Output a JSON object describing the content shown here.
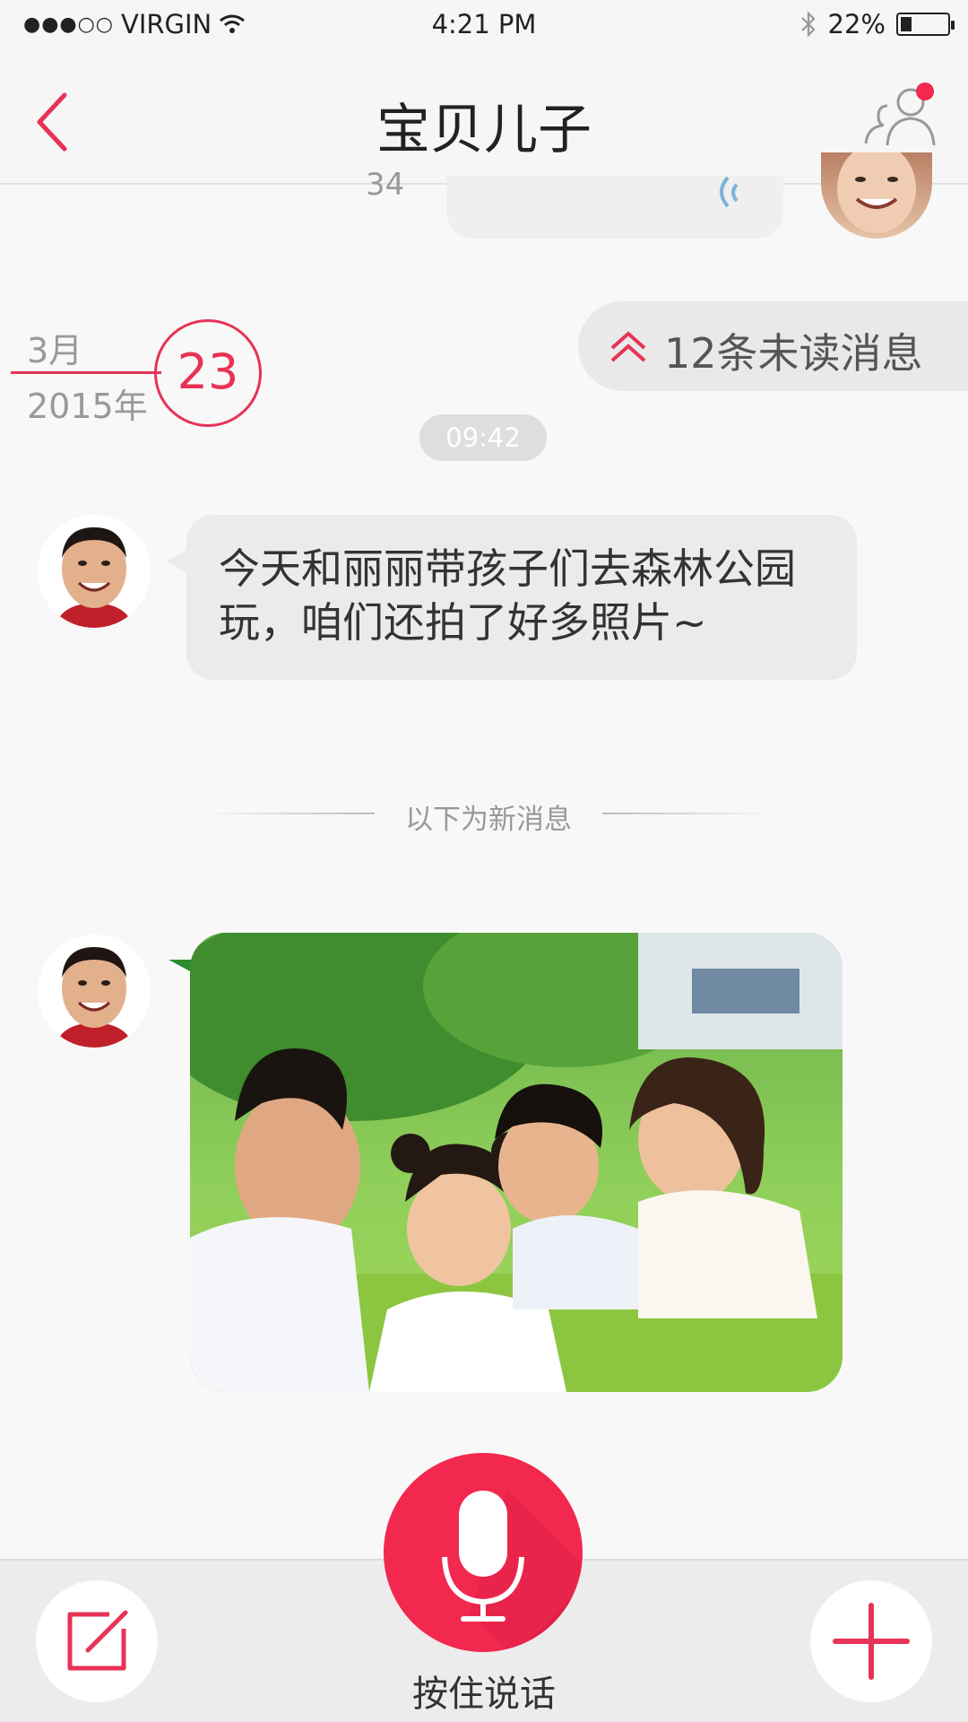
{
  "status_bar": {
    "carrier": "VIRGIN",
    "signal_dots": "●●●○○",
    "time": "4:21 PM",
    "battery": "22%",
    "battery_level": 0.22
  },
  "nav": {
    "title": "宝贝儿子"
  },
  "previous_message": {
    "duration_fragment": "34"
  },
  "date": {
    "month": "3月",
    "year": "2015年",
    "day": "23"
  },
  "unread": {
    "label": "12条未读消息"
  },
  "chat": {
    "time_pill": "09:42",
    "text_message": {
      "line1": "今天和丽丽带孩子们去森林公园",
      "line2": "玩，咱们还拍了好多照片~"
    },
    "divider": "以下为新消息"
  },
  "bottom_bar": {
    "mic_label": "按住说话"
  },
  "colors": {
    "accent": "#e83256",
    "mic": "#f2284f",
    "bubble": "#ebebeb",
    "background": "#f8f8f8"
  },
  "icons": [
    "back-chevron-icon",
    "people-icon",
    "notification-dot-icon",
    "double-chevron-up-icon",
    "microphone-icon",
    "compose-icon",
    "plus-icon",
    "voice-wave-icon"
  ]
}
